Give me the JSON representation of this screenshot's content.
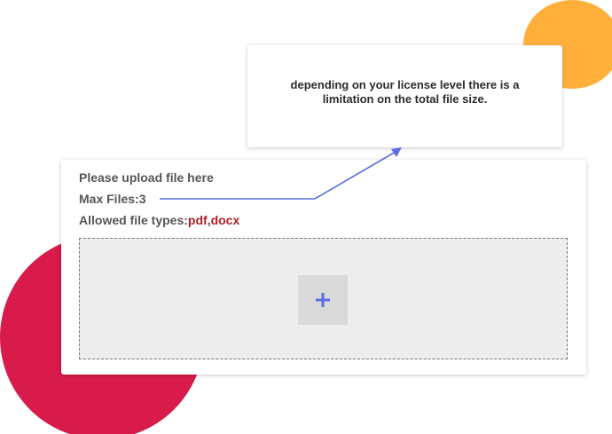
{
  "tooltip": {
    "text": "depending on your license level there is a limitation on the total file size."
  },
  "upload": {
    "prompt": "Please upload file here",
    "max_files_label": "Max Files:",
    "max_files_value": "3",
    "allowed_types_label": "Allowed file types:",
    "allowed_types": [
      "pdf",
      "docx"
    ],
    "type_separator": ",",
    "add_icon": "plus-icon"
  },
  "colors": {
    "accent_blue": "#5b6ee1",
    "file_type_red": "#b11e24",
    "orange_blob": "#ffb03b",
    "red_blob": "#d81b4a",
    "dropzone_bg": "#ededed"
  }
}
